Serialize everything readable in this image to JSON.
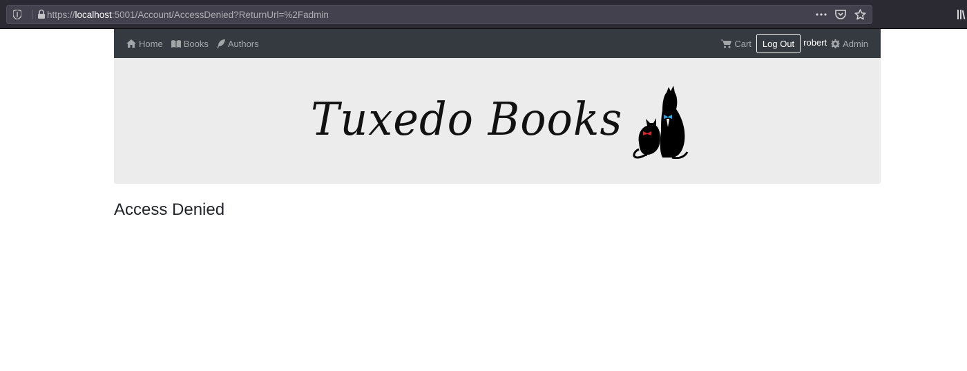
{
  "browser": {
    "url_scheme": "https://",
    "url_host": "localhost",
    "url_path": ":5001/Account/AccessDenied?ReturnUrl=%2Fadmin"
  },
  "navbar": {
    "left_items": [
      {
        "label": "Home",
        "icon": "home-icon"
      },
      {
        "label": "Books",
        "icon": "book-icon"
      },
      {
        "label": "Authors",
        "icon": "feather-icon"
      }
    ],
    "cart_label": "Cart",
    "logout_label": "Log Out",
    "username": "robert",
    "admin_label": "Admin"
  },
  "banner": {
    "logo_text": "Tuxedo Books"
  },
  "main": {
    "heading": "Access Denied"
  },
  "colors": {
    "navbar_bg": "#343a40",
    "jumbotron_bg": "#ececec",
    "browser_chrome": "#2b2a33"
  }
}
